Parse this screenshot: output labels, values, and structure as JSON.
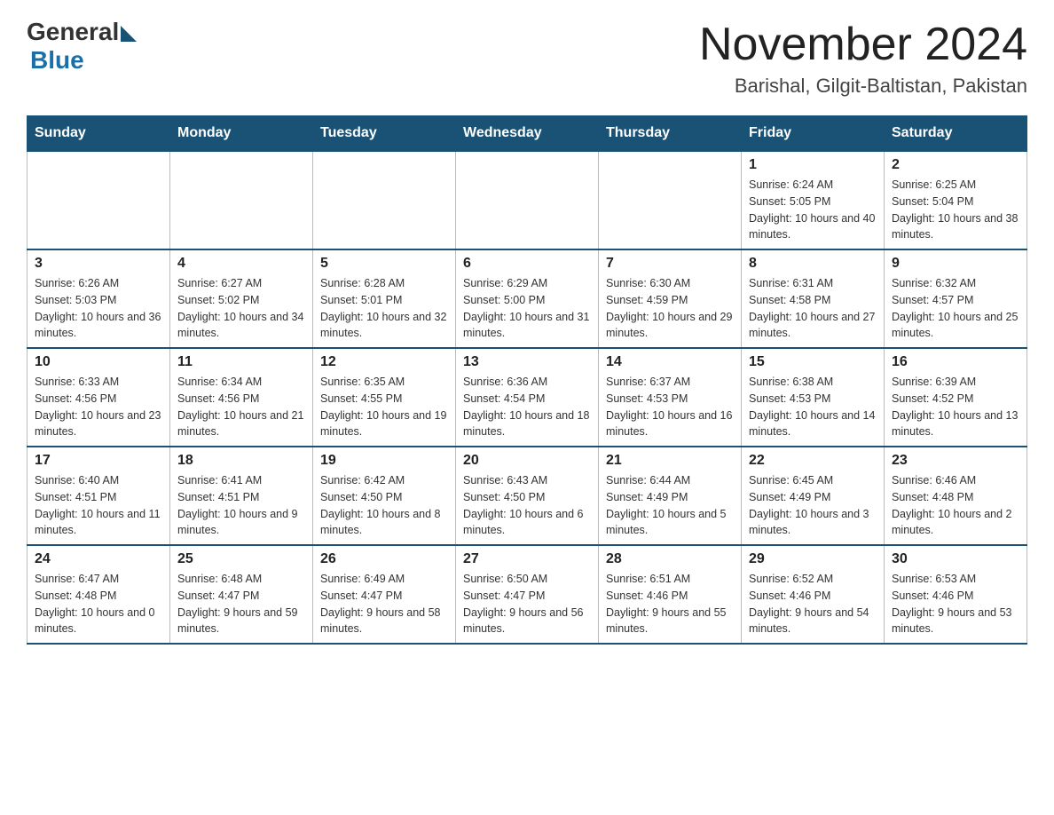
{
  "logo": {
    "general": "General",
    "blue": "Blue"
  },
  "title": "November 2024",
  "location": "Barishal, Gilgit-Baltistan, Pakistan",
  "days_of_week": [
    "Sunday",
    "Monday",
    "Tuesday",
    "Wednesday",
    "Thursday",
    "Friday",
    "Saturday"
  ],
  "weeks": [
    [
      {
        "day": "",
        "info": ""
      },
      {
        "day": "",
        "info": ""
      },
      {
        "day": "",
        "info": ""
      },
      {
        "day": "",
        "info": ""
      },
      {
        "day": "",
        "info": ""
      },
      {
        "day": "1",
        "info": "Sunrise: 6:24 AM\nSunset: 5:05 PM\nDaylight: 10 hours and 40 minutes."
      },
      {
        "day": "2",
        "info": "Sunrise: 6:25 AM\nSunset: 5:04 PM\nDaylight: 10 hours and 38 minutes."
      }
    ],
    [
      {
        "day": "3",
        "info": "Sunrise: 6:26 AM\nSunset: 5:03 PM\nDaylight: 10 hours and 36 minutes."
      },
      {
        "day": "4",
        "info": "Sunrise: 6:27 AM\nSunset: 5:02 PM\nDaylight: 10 hours and 34 minutes."
      },
      {
        "day": "5",
        "info": "Sunrise: 6:28 AM\nSunset: 5:01 PM\nDaylight: 10 hours and 32 minutes."
      },
      {
        "day": "6",
        "info": "Sunrise: 6:29 AM\nSunset: 5:00 PM\nDaylight: 10 hours and 31 minutes."
      },
      {
        "day": "7",
        "info": "Sunrise: 6:30 AM\nSunset: 4:59 PM\nDaylight: 10 hours and 29 minutes."
      },
      {
        "day": "8",
        "info": "Sunrise: 6:31 AM\nSunset: 4:58 PM\nDaylight: 10 hours and 27 minutes."
      },
      {
        "day": "9",
        "info": "Sunrise: 6:32 AM\nSunset: 4:57 PM\nDaylight: 10 hours and 25 minutes."
      }
    ],
    [
      {
        "day": "10",
        "info": "Sunrise: 6:33 AM\nSunset: 4:56 PM\nDaylight: 10 hours and 23 minutes."
      },
      {
        "day": "11",
        "info": "Sunrise: 6:34 AM\nSunset: 4:56 PM\nDaylight: 10 hours and 21 minutes."
      },
      {
        "day": "12",
        "info": "Sunrise: 6:35 AM\nSunset: 4:55 PM\nDaylight: 10 hours and 19 minutes."
      },
      {
        "day": "13",
        "info": "Sunrise: 6:36 AM\nSunset: 4:54 PM\nDaylight: 10 hours and 18 minutes."
      },
      {
        "day": "14",
        "info": "Sunrise: 6:37 AM\nSunset: 4:53 PM\nDaylight: 10 hours and 16 minutes."
      },
      {
        "day": "15",
        "info": "Sunrise: 6:38 AM\nSunset: 4:53 PM\nDaylight: 10 hours and 14 minutes."
      },
      {
        "day": "16",
        "info": "Sunrise: 6:39 AM\nSunset: 4:52 PM\nDaylight: 10 hours and 13 minutes."
      }
    ],
    [
      {
        "day": "17",
        "info": "Sunrise: 6:40 AM\nSunset: 4:51 PM\nDaylight: 10 hours and 11 minutes."
      },
      {
        "day": "18",
        "info": "Sunrise: 6:41 AM\nSunset: 4:51 PM\nDaylight: 10 hours and 9 minutes."
      },
      {
        "day": "19",
        "info": "Sunrise: 6:42 AM\nSunset: 4:50 PM\nDaylight: 10 hours and 8 minutes."
      },
      {
        "day": "20",
        "info": "Sunrise: 6:43 AM\nSunset: 4:50 PM\nDaylight: 10 hours and 6 minutes."
      },
      {
        "day": "21",
        "info": "Sunrise: 6:44 AM\nSunset: 4:49 PM\nDaylight: 10 hours and 5 minutes."
      },
      {
        "day": "22",
        "info": "Sunrise: 6:45 AM\nSunset: 4:49 PM\nDaylight: 10 hours and 3 minutes."
      },
      {
        "day": "23",
        "info": "Sunrise: 6:46 AM\nSunset: 4:48 PM\nDaylight: 10 hours and 2 minutes."
      }
    ],
    [
      {
        "day": "24",
        "info": "Sunrise: 6:47 AM\nSunset: 4:48 PM\nDaylight: 10 hours and 0 minutes."
      },
      {
        "day": "25",
        "info": "Sunrise: 6:48 AM\nSunset: 4:47 PM\nDaylight: 9 hours and 59 minutes."
      },
      {
        "day": "26",
        "info": "Sunrise: 6:49 AM\nSunset: 4:47 PM\nDaylight: 9 hours and 58 minutes."
      },
      {
        "day": "27",
        "info": "Sunrise: 6:50 AM\nSunset: 4:47 PM\nDaylight: 9 hours and 56 minutes."
      },
      {
        "day": "28",
        "info": "Sunrise: 6:51 AM\nSunset: 4:46 PM\nDaylight: 9 hours and 55 minutes."
      },
      {
        "day": "29",
        "info": "Sunrise: 6:52 AM\nSunset: 4:46 PM\nDaylight: 9 hours and 54 minutes."
      },
      {
        "day": "30",
        "info": "Sunrise: 6:53 AM\nSunset: 4:46 PM\nDaylight: 9 hours and 53 minutes."
      }
    ]
  ]
}
